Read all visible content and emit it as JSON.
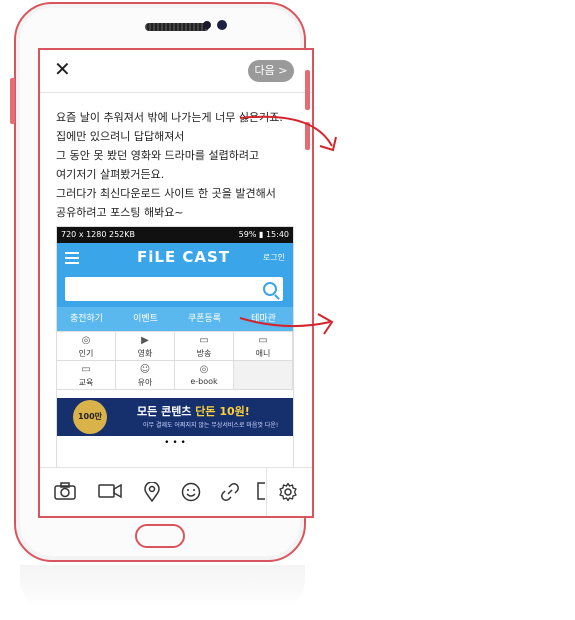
{
  "header": {
    "close_icon": "✕",
    "next_label": "다음 >"
  },
  "body_text": [
    "요즘 날이 추워져서 밖에 나가는게 너무 싫은거죠.",
    "집에만 있으려니 답답해져서",
    "그 동안 못 봤던 영화와 드라마를 설렵하려고",
    "여기저기 살펴봤거든요.",
    "그러다가 최신다운로드 사이트 한 곳을 발견해서",
    "공유하려고 포스팅 해봐요~"
  ],
  "screenshot": {
    "status_left": "720 x 1280  252KB",
    "status_right": "59% ▮ 15:40",
    "logo": "FiLE CAST",
    "login": "로그인",
    "tabs": [
      "충전하기",
      "이벤트",
      "쿠폰등록",
      "테마관"
    ],
    "categories": [
      {
        "icon": "◎",
        "label": "인기"
      },
      {
        "icon": "▶",
        "label": "영화"
      },
      {
        "icon": "▭",
        "label": "방송"
      },
      {
        "icon": "▭",
        "label": "애니"
      },
      {
        "icon": "▭",
        "label": "교육"
      },
      {
        "icon": "☺",
        "label": "유아"
      },
      {
        "icon": "◎",
        "label": "e-book"
      }
    ],
    "banner_medal": "100만",
    "banner_title_a": "모든 콘텐츠 ",
    "banner_title_b": "단돈 10원!",
    "banner_sub": "아무 결제도 어쩌지지 않는 무상서비스로 마음껏 다운!",
    "dots": "• • •"
  },
  "toolbar": {
    "icons": [
      "camera-icon",
      "video-icon",
      "location-icon",
      "emoji-icon",
      "link-icon",
      "file-icon",
      "settings-icon"
    ]
  },
  "colors": {
    "phone_outline": "#d9545c",
    "accent_blue": "#3aa5e8",
    "arrow_red": "#d4242b"
  }
}
